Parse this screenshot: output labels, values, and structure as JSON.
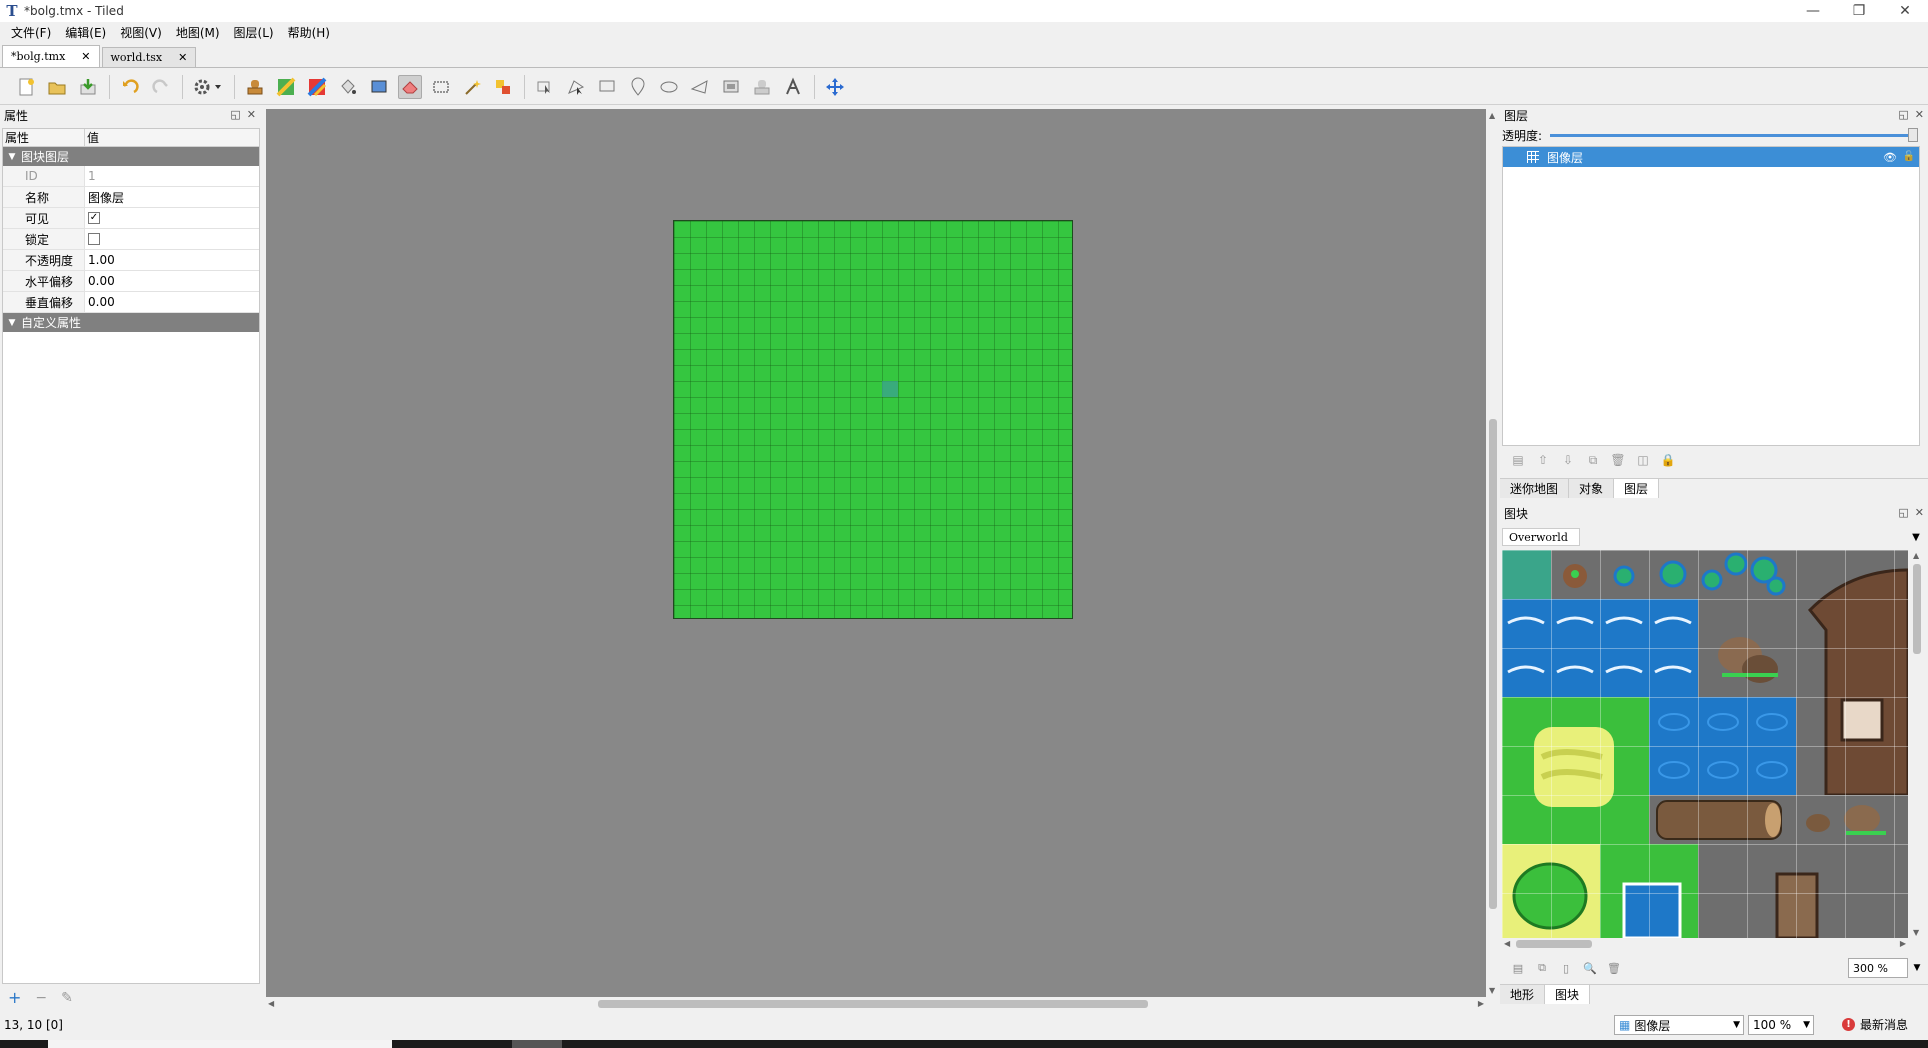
{
  "window": {
    "title": "*bolg.tmx - Tiled",
    "app_icon": "T"
  },
  "window_buttons": {
    "minimize": "—",
    "restore": "❐",
    "close": "✕"
  },
  "menu": [
    "文件(F)",
    "编辑(E)",
    "视图(V)",
    "地图(M)",
    "图层(L)",
    "帮助(H)"
  ],
  "tabs": [
    {
      "label": "*bolg.tmx",
      "close": "✕"
    },
    {
      "label": "world.tsx",
      "close": "✕"
    }
  ],
  "toolbar_icons": [
    "new-file-icon",
    "open-folder-icon",
    "save-icon",
    "undo-icon",
    "redo-icon",
    "settings-cog-icon",
    "stamp-brush-icon",
    "terrain-brush-icon",
    "wang-brush-icon",
    "bucket-fill-icon",
    "shape-fill-icon",
    "eraser-icon",
    "rect-select-icon",
    "magic-wand-icon",
    "select-same-tile-icon",
    "select-objects-icon",
    "edit-polygons-icon",
    "insert-rectangle-icon",
    "insert-point-icon",
    "insert-ellipse-icon",
    "insert-polygon-icon",
    "insert-tile-icon",
    "insert-template-icon",
    "insert-text-icon",
    "world-tool-icon"
  ],
  "properties": {
    "title": "属性",
    "col_name": "属性",
    "col_value": "值",
    "group_title": "图块图层",
    "rows": {
      "id": {
        "key": "ID",
        "value": "1"
      },
      "name": {
        "key": "名称",
        "value": "图像层"
      },
      "visible": {
        "key": "可见",
        "checked": "✓"
      },
      "locked": {
        "key": "锁定"
      },
      "opacity": {
        "key": "不透明度",
        "value": "1.00"
      },
      "offset_x": {
        "key": "水平偏移",
        "value": "0.00"
      },
      "offset_y": {
        "key": "垂直偏移",
        "value": "0.00"
      }
    },
    "custom_group": "自定义属性",
    "add": "+",
    "remove": "−",
    "rename": "✎"
  },
  "layers": {
    "title": "图层",
    "opacity_label": "透明度:",
    "opacity_value": 1.0,
    "items": [
      {
        "name": "图像层"
      }
    ],
    "subtabs": [
      "迷你地图",
      "对象",
      "图层"
    ]
  },
  "tileset": {
    "title": "图块",
    "name": "Overworld",
    "zoom": "300 %",
    "subtabs": [
      "地形",
      "图块"
    ]
  },
  "status": {
    "coords": "13, 10 [0]",
    "layer": "图像层",
    "zoom": "100 %",
    "news": "最新消息",
    "news_icon": "!"
  },
  "colors": {
    "grass": "#35c640",
    "canvas_bg": "#888888",
    "selection": "#3c8ed6",
    "water": "#1e78c8"
  }
}
